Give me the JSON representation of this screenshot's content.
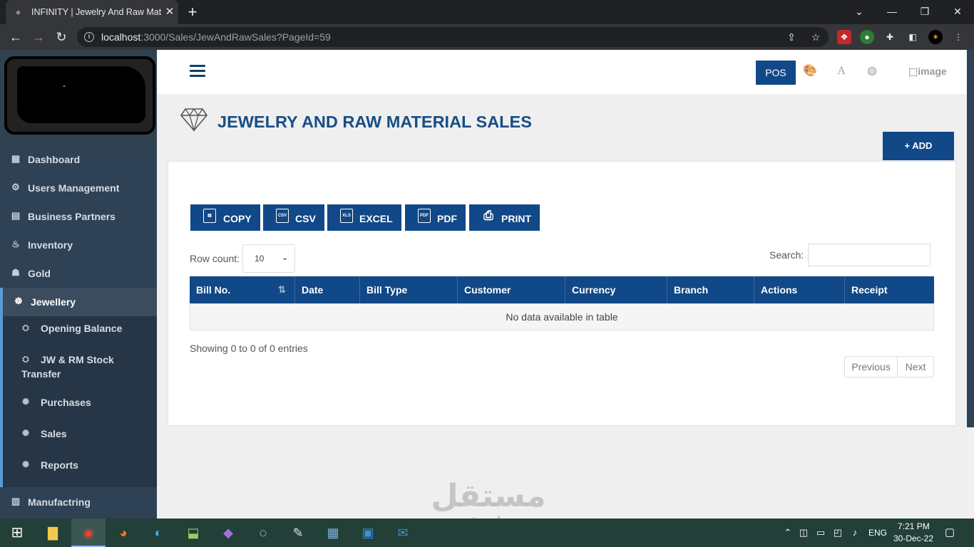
{
  "browser": {
    "tab_title": "INFINITY | Jewelry And Raw Mate",
    "url_host": "localhost",
    "url_path": ":3000/Sales/JewAndRawSales?PageId=59"
  },
  "sidebar": {
    "items": [
      {
        "label": "Dashboard",
        "icon": "dashboard-icon"
      },
      {
        "label": "Users Management",
        "icon": "gear-icon"
      },
      {
        "label": "Business Partners",
        "icon": "partners-icon"
      },
      {
        "label": "Inventory",
        "icon": "inventory-icon"
      },
      {
        "label": "Gold",
        "icon": "gold-icon"
      },
      {
        "label": "Jewellery",
        "icon": "ring-icon"
      },
      {
        "label": "Manufactring",
        "icon": "factory-icon"
      }
    ],
    "sub_items": [
      {
        "label": "Opening Balance"
      },
      {
        "label_line1": "JW & RM Stock",
        "label_line2": "Transfer"
      },
      {
        "label": "Purchases"
      },
      {
        "label": "Sales"
      },
      {
        "label": "Reports"
      }
    ]
  },
  "topbar": {
    "pos_label": "POS",
    "image_alt": "image"
  },
  "page": {
    "title": "JEWELRY AND RAW MATERIAL SALES",
    "add_label": "+ ADD"
  },
  "export_buttons": [
    {
      "label": "COPY",
      "icon": "copy-icon"
    },
    {
      "label": "CSV",
      "icon": "csv-icon"
    },
    {
      "label": "EXCEL",
      "icon": "excel-icon"
    },
    {
      "label": "PDF",
      "icon": "pdf-icon"
    },
    {
      "label": "PRINT",
      "icon": "print-icon"
    }
  ],
  "table": {
    "row_count_label": "Row count:",
    "row_count_value": "10",
    "search_label": "Search:",
    "columns": [
      "Bill No.",
      "Date",
      "Bill Type",
      "Customer",
      "Currency",
      "Branch",
      "Actions",
      "Receipt"
    ],
    "empty_text": "No data available in table",
    "showing_text": "Showing 0 to 0 of 0 entries",
    "previous_label": "Previous",
    "next_label": "Next"
  },
  "watermark": {
    "arabic": "مستقل",
    "latin": "mostaql.com"
  },
  "taskbar": {
    "language": "ENG",
    "time": "7:21 PM",
    "date": "30-Dec-22"
  }
}
